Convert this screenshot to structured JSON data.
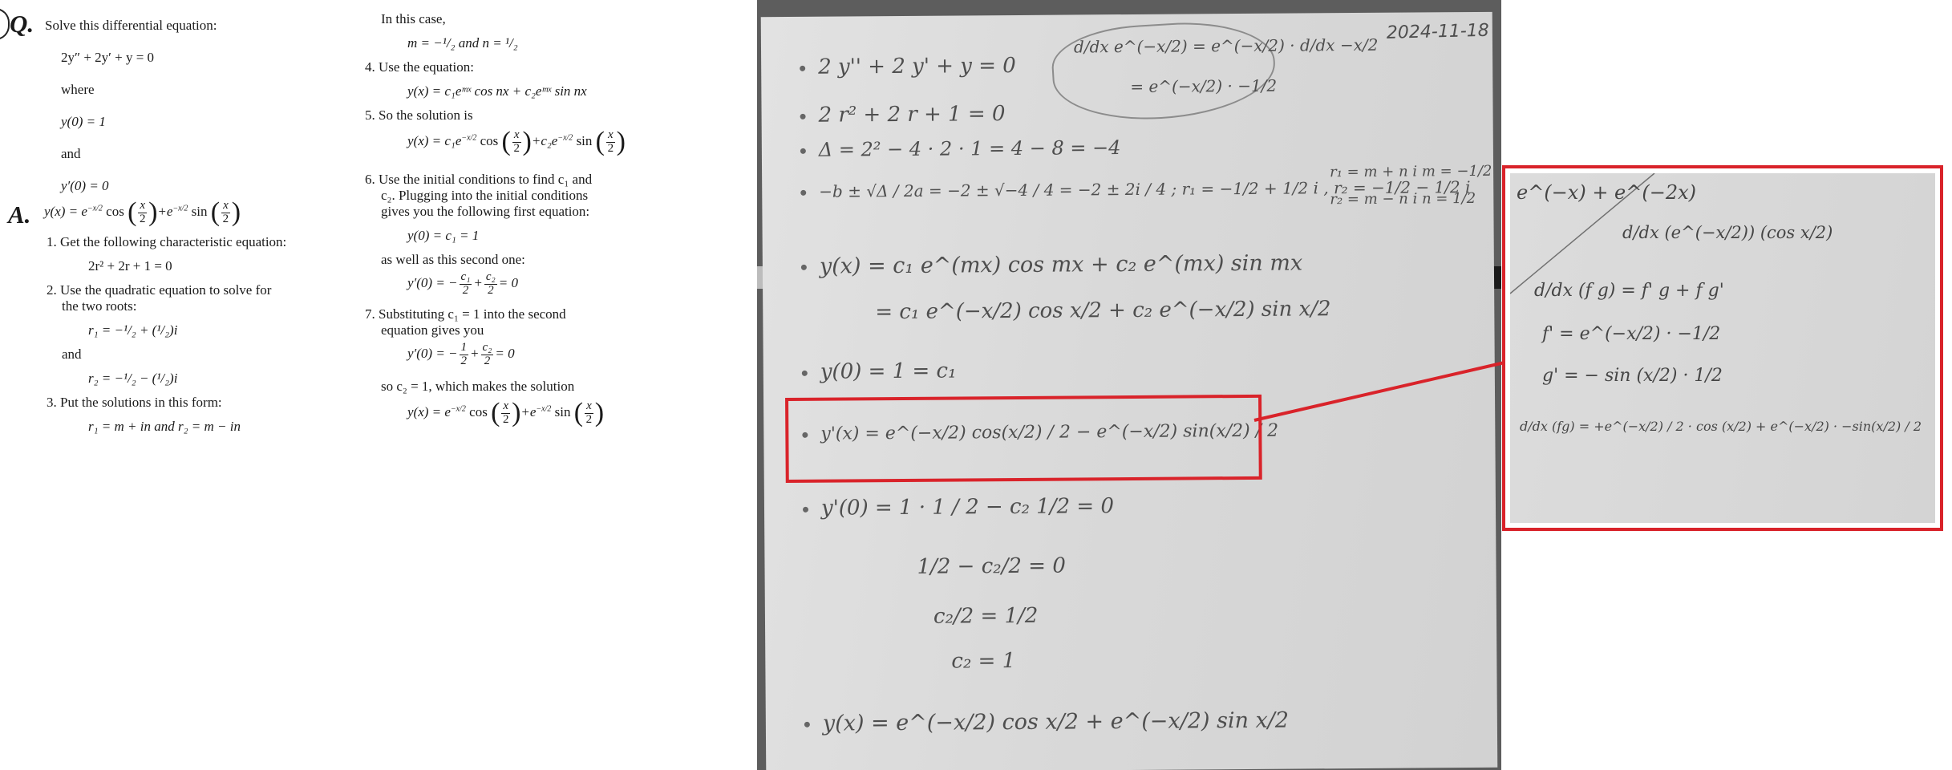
{
  "question": {
    "letter": "Q.",
    "prompt": "Solve this differential equation:",
    "equation": "2y″ + 2y′ + y = 0",
    "where": "where",
    "cond1": "y(0) = 1",
    "and": "and",
    "cond2": "y′(0) = 0"
  },
  "answer": {
    "letter": "A.",
    "result_lhs": "y(x) = e",
    "exp": "−x/2",
    "cos": "cos",
    "sin": "sin",
    "plus": "+e",
    "x": "x",
    "two": "2"
  },
  "steps_left": {
    "s1_num": "1.",
    "s1": "Get the following characteristic equation:",
    "s1_eq": "2r² + 2r + 1 = 0",
    "s2_num": "2.",
    "s2a": "Use the quadratic equation to solve for",
    "s2b": "the two roots:",
    "r1": "r₁ = −¹/₂ + (¹/₂)i",
    "and": "and",
    "r2": "r₂ = −¹/₂ − (¹/₂)i",
    "s3_num": "3.",
    "s3": "Put the solutions in this form:",
    "s3_eq": "r₁ = m + in and r₂ = m − in"
  },
  "steps_right": {
    "case": "In this case,",
    "mn": "m = −¹/₂ and n = ¹/₂",
    "s4_num": "4.",
    "s4": "Use the equation:",
    "s4_eq": "y(x) = c₁eᵐˣ cos nx + c₂eᵐˣ sin nx",
    "s5_num": "5.",
    "s5": "So the solution is",
    "s5_eq_a": "y(x) = c₁e",
    "s5_eq_b": "+c₂e",
    "s6_num": "6.",
    "s6a": "Use the initial conditions to find c₁ and",
    "s6b": "c₂. Plugging into the initial conditions",
    "s6c": "gives you the following first equation:",
    "s6_eq": "y(0) = c₁ = 1",
    "s6d": "as well as this second one:",
    "s6_eq2a": "y′(0) = −",
    "c1": "c₁",
    "c2": "c₂",
    "s6_eq2b": "= 0",
    "s7_num": "7.",
    "s7a": "Substituting c₁ = 1 into the second",
    "s7b": "equation gives you",
    "s7_eq_a": "y′(0) = −",
    "one": "1",
    "s7_c2": "so c₂ = 1, which makes the solution",
    "final_a": "y(x) = e",
    "final_b": "+e",
    "cos": "cos",
    "sin": "sin",
    "minus_half_x": "−x/2",
    "plus": "+",
    "x": "x",
    "two": "2"
  },
  "notebook": {
    "date": "2024-11-18",
    "cloud_1": "d/dx e^(−x/2) = e^(−x/2) · d/dx −x/2",
    "cloud_2": "= e^(−x/2) · −1/2",
    "l1": "2 y'' + 2 y' + y = 0",
    "l2": "2 r² + 2 r + 1 = 0",
    "l3": "Δ = 2² − 4 · 2 · 1 = 4 − 8 = −4",
    "l4": "−b ± √Δ / 2a = −2 ± √−4 / 4 = −2 ± 2i / 4 ; r₁ = −1/2 + 1/2 i , r₂ = −1/2 − 1/2 i",
    "l4b": "r₁ = m + n i   m = −1/2",
    "l4c": "r₂ = m − n i   n = 1/2",
    "l5": "y(x) = c₁ e^(mx) cos mx + c₂ e^(mx) sin mx",
    "l6": "= c₁ e^(−x/2) cos x/2 + c₂ e^(−x/2) sin x/2",
    "l7": "y(0) = 1 = c₁",
    "l8": "y'(x) = e^(−x/2) cos(x/2) / 2 − e^(−x/2) sin(x/2) / 2",
    "l9": "y'(0) = 1 · 1 / 2     − c₂ 1/2 = 0",
    "l10": "1/2 − c₂/2 = 0",
    "l11": "c₂/2 = 1/2",
    "l12": "c₂ = 1",
    "l13": "y(x) = e^(−x/2) cos x/2 + e^(−x/2) sin x/2"
  },
  "inset": {
    "l1": "e^(−x) + e^(−2x)",
    "l2": "d/dx (e^(−x/2)) (cos x/2)",
    "l3": "d/dx (f g) = f' g + f g'",
    "l4": "f' = e^(−x/2) · −1/2",
    "l5": "g' = − sin (x/2) · 1/2",
    "l6": "d/dx (fg) = +e^(−x/2) / 2 · cos (x/2) + e^(−x/2) · −sin(x/2) / 2"
  },
  "colors": {
    "annotation_red": "#d9232a",
    "ink": "#4e4e4e"
  }
}
